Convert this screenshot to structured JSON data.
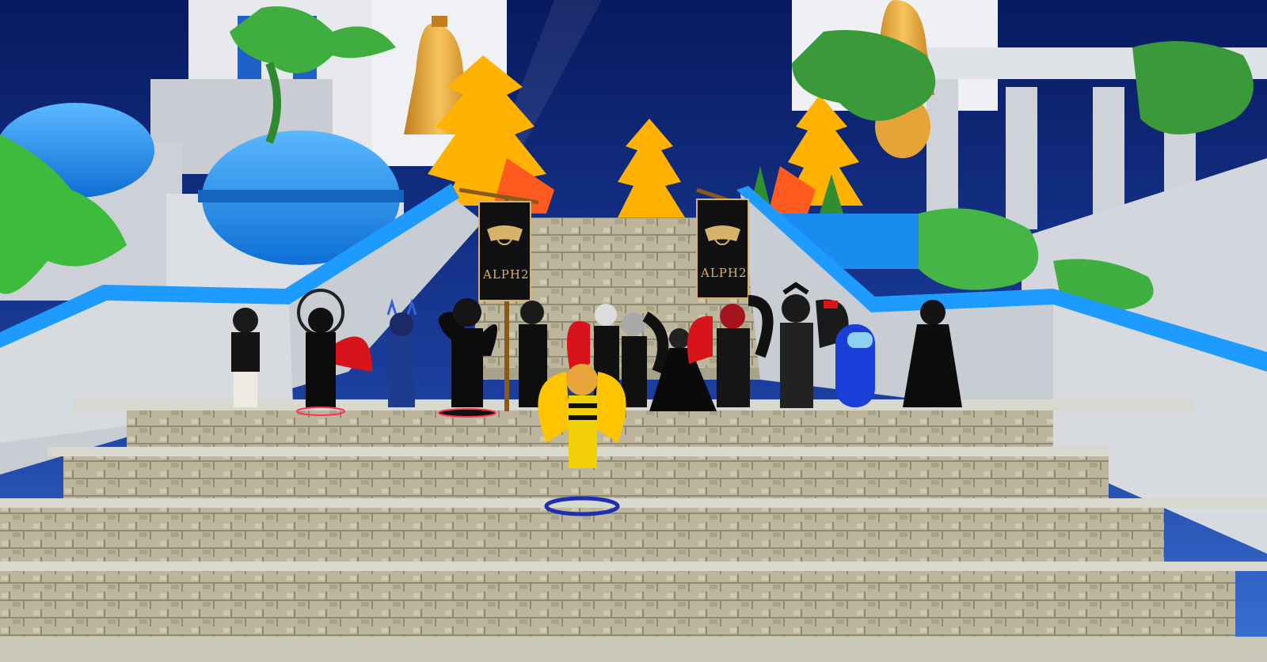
{
  "scene": {
    "colors": {
      "sky_top": "#0b1e6b",
      "sky_bottom": "#2f6fd0",
      "dome_blue": "#1e88e5",
      "railing_blue": "#1e9bff",
      "marble": "#d6d9de",
      "stone": "#b9b39a",
      "autumn_orange": "#ffb300",
      "foliage_green": "#3fa535",
      "bell_gold": "#e8a93a",
      "banner_black": "#111111",
      "banner_gold": "#d8b26a"
    }
  },
  "banners": [
    {
      "name": "left-banner",
      "text": "ALPH2"
    },
    {
      "name": "right-banner",
      "text": "ALPH2"
    }
  ],
  "avatars": [
    {
      "name": "avatar-military-jacket",
      "outfit": "black-white"
    },
    {
      "name": "avatar-red-wings-halo",
      "outfit": "black-red"
    },
    {
      "name": "avatar-blue-horns",
      "outfit": "blue"
    },
    {
      "name": "avatar-black-wings-spiky",
      "outfit": "black"
    },
    {
      "name": "avatar-suit-banner-bearer",
      "outfit": "black"
    },
    {
      "name": "avatar-red-wings-suit",
      "outfit": "black-red"
    },
    {
      "name": "avatar-grey-hair",
      "outfit": "black"
    },
    {
      "name": "avatar-black-gown",
      "outfit": "black"
    },
    {
      "name": "avatar-red-demon-wings",
      "outfit": "black-red"
    },
    {
      "name": "avatar-black-armor",
      "outfit": "black"
    },
    {
      "name": "avatar-among-us-blue",
      "outfit": "blue"
    },
    {
      "name": "avatar-long-coat",
      "outfit": "black"
    },
    {
      "name": "avatar-gold-wings-player",
      "outfit": "gold"
    }
  ]
}
